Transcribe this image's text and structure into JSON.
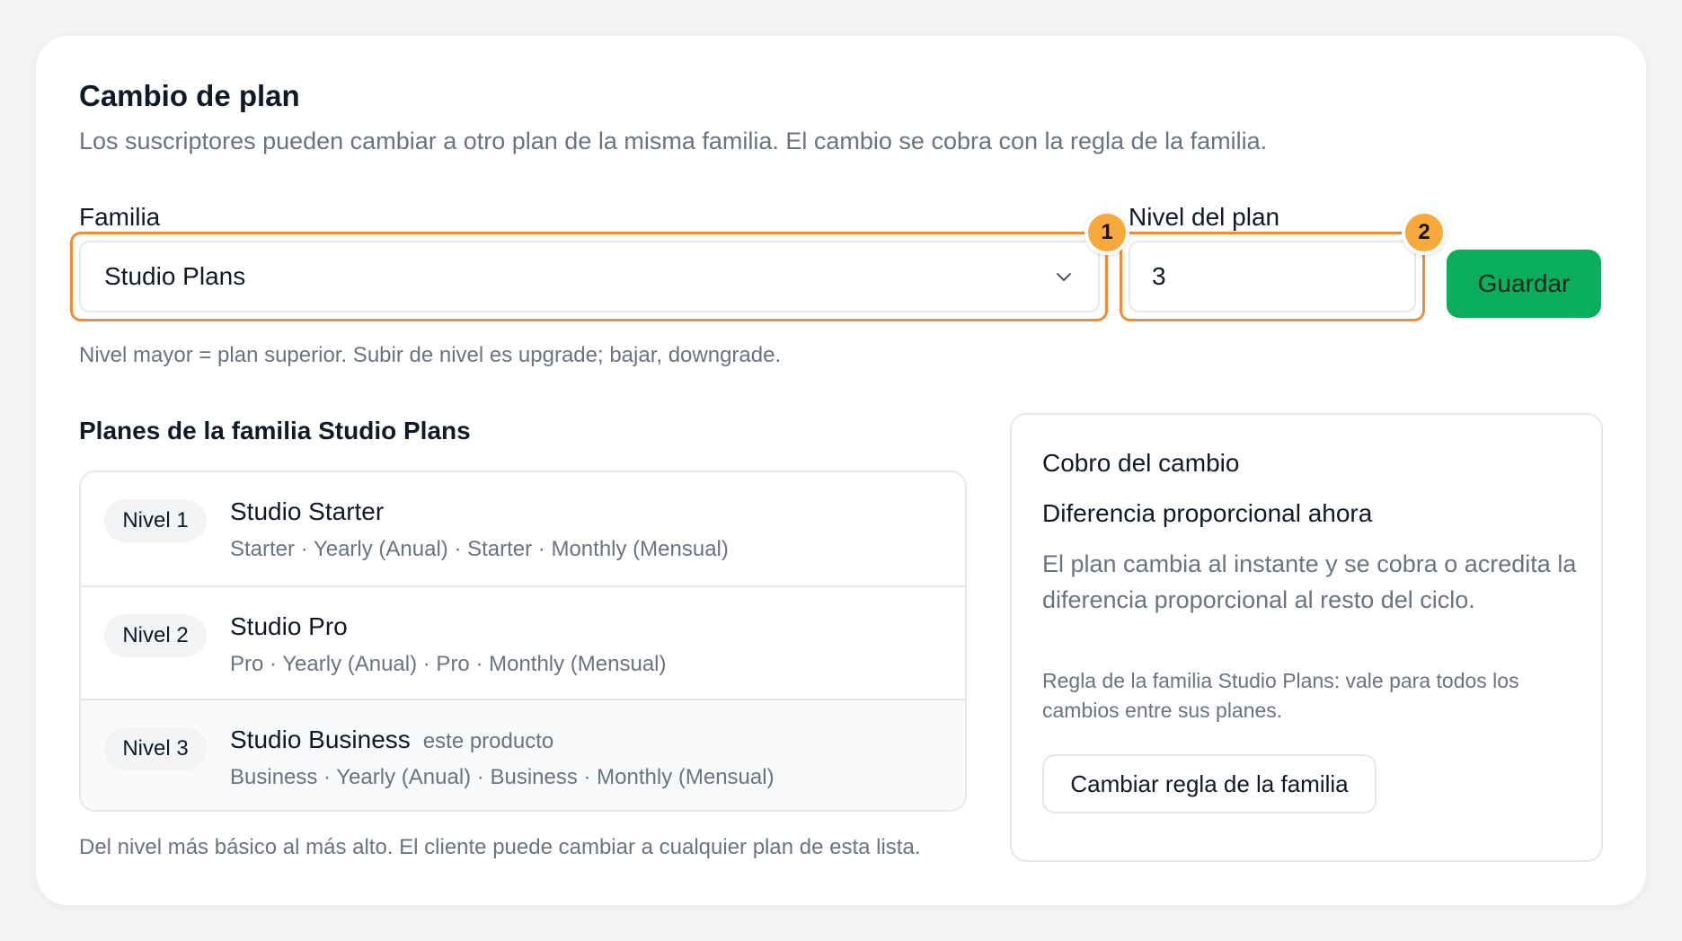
{
  "header": {
    "title": "Cambio de plan",
    "subtitle": "Los suscriptores pueden cambiar a otro plan de la misma familia. El cambio se cobra con la regla de la familia."
  },
  "form": {
    "family_label": "Familia",
    "family_value": "Studio Plans",
    "level_label": "Nivel del plan",
    "level_value": "3",
    "save_label": "Guardar",
    "hint": "Nivel mayor = plan superior. Subir de nivel es upgrade; bajar, downgrade.",
    "badges": [
      "1",
      "2"
    ]
  },
  "plans": {
    "title": "Planes de la familia Studio Plans",
    "items": [
      {
        "level": "Nivel 1",
        "name": "Studio Starter",
        "tag": "",
        "desc": "Starter · Yearly (Anual) · Starter · Monthly (Mensual)"
      },
      {
        "level": "Nivel 2",
        "name": "Studio Pro",
        "tag": "",
        "desc": "Pro · Yearly (Anual) · Pro · Monthly (Mensual)"
      },
      {
        "level": "Nivel 3",
        "name": "Studio Business",
        "tag": "este producto",
        "desc": "Business · Yearly (Anual) · Business · Monthly (Mensual)"
      }
    ],
    "footer": "Del nivel más básico al más alto. El cliente puede cambiar a cualquier plan de esta lista."
  },
  "billing": {
    "title": "Cobro del cambio",
    "rule": "Diferencia proporcional ahora",
    "description": "El plan cambia al instante y se cobra o acredita la diferencia proporcional al resto del ciclo.",
    "note": "Regla de la familia Studio Plans: vale para todos los cambios entre sus planes.",
    "button_label": "Cambiar regla de la familia"
  },
  "colors": {
    "accent": "#0aae5c",
    "highlight": "#f08a3c",
    "badge": "#f8a93b"
  }
}
